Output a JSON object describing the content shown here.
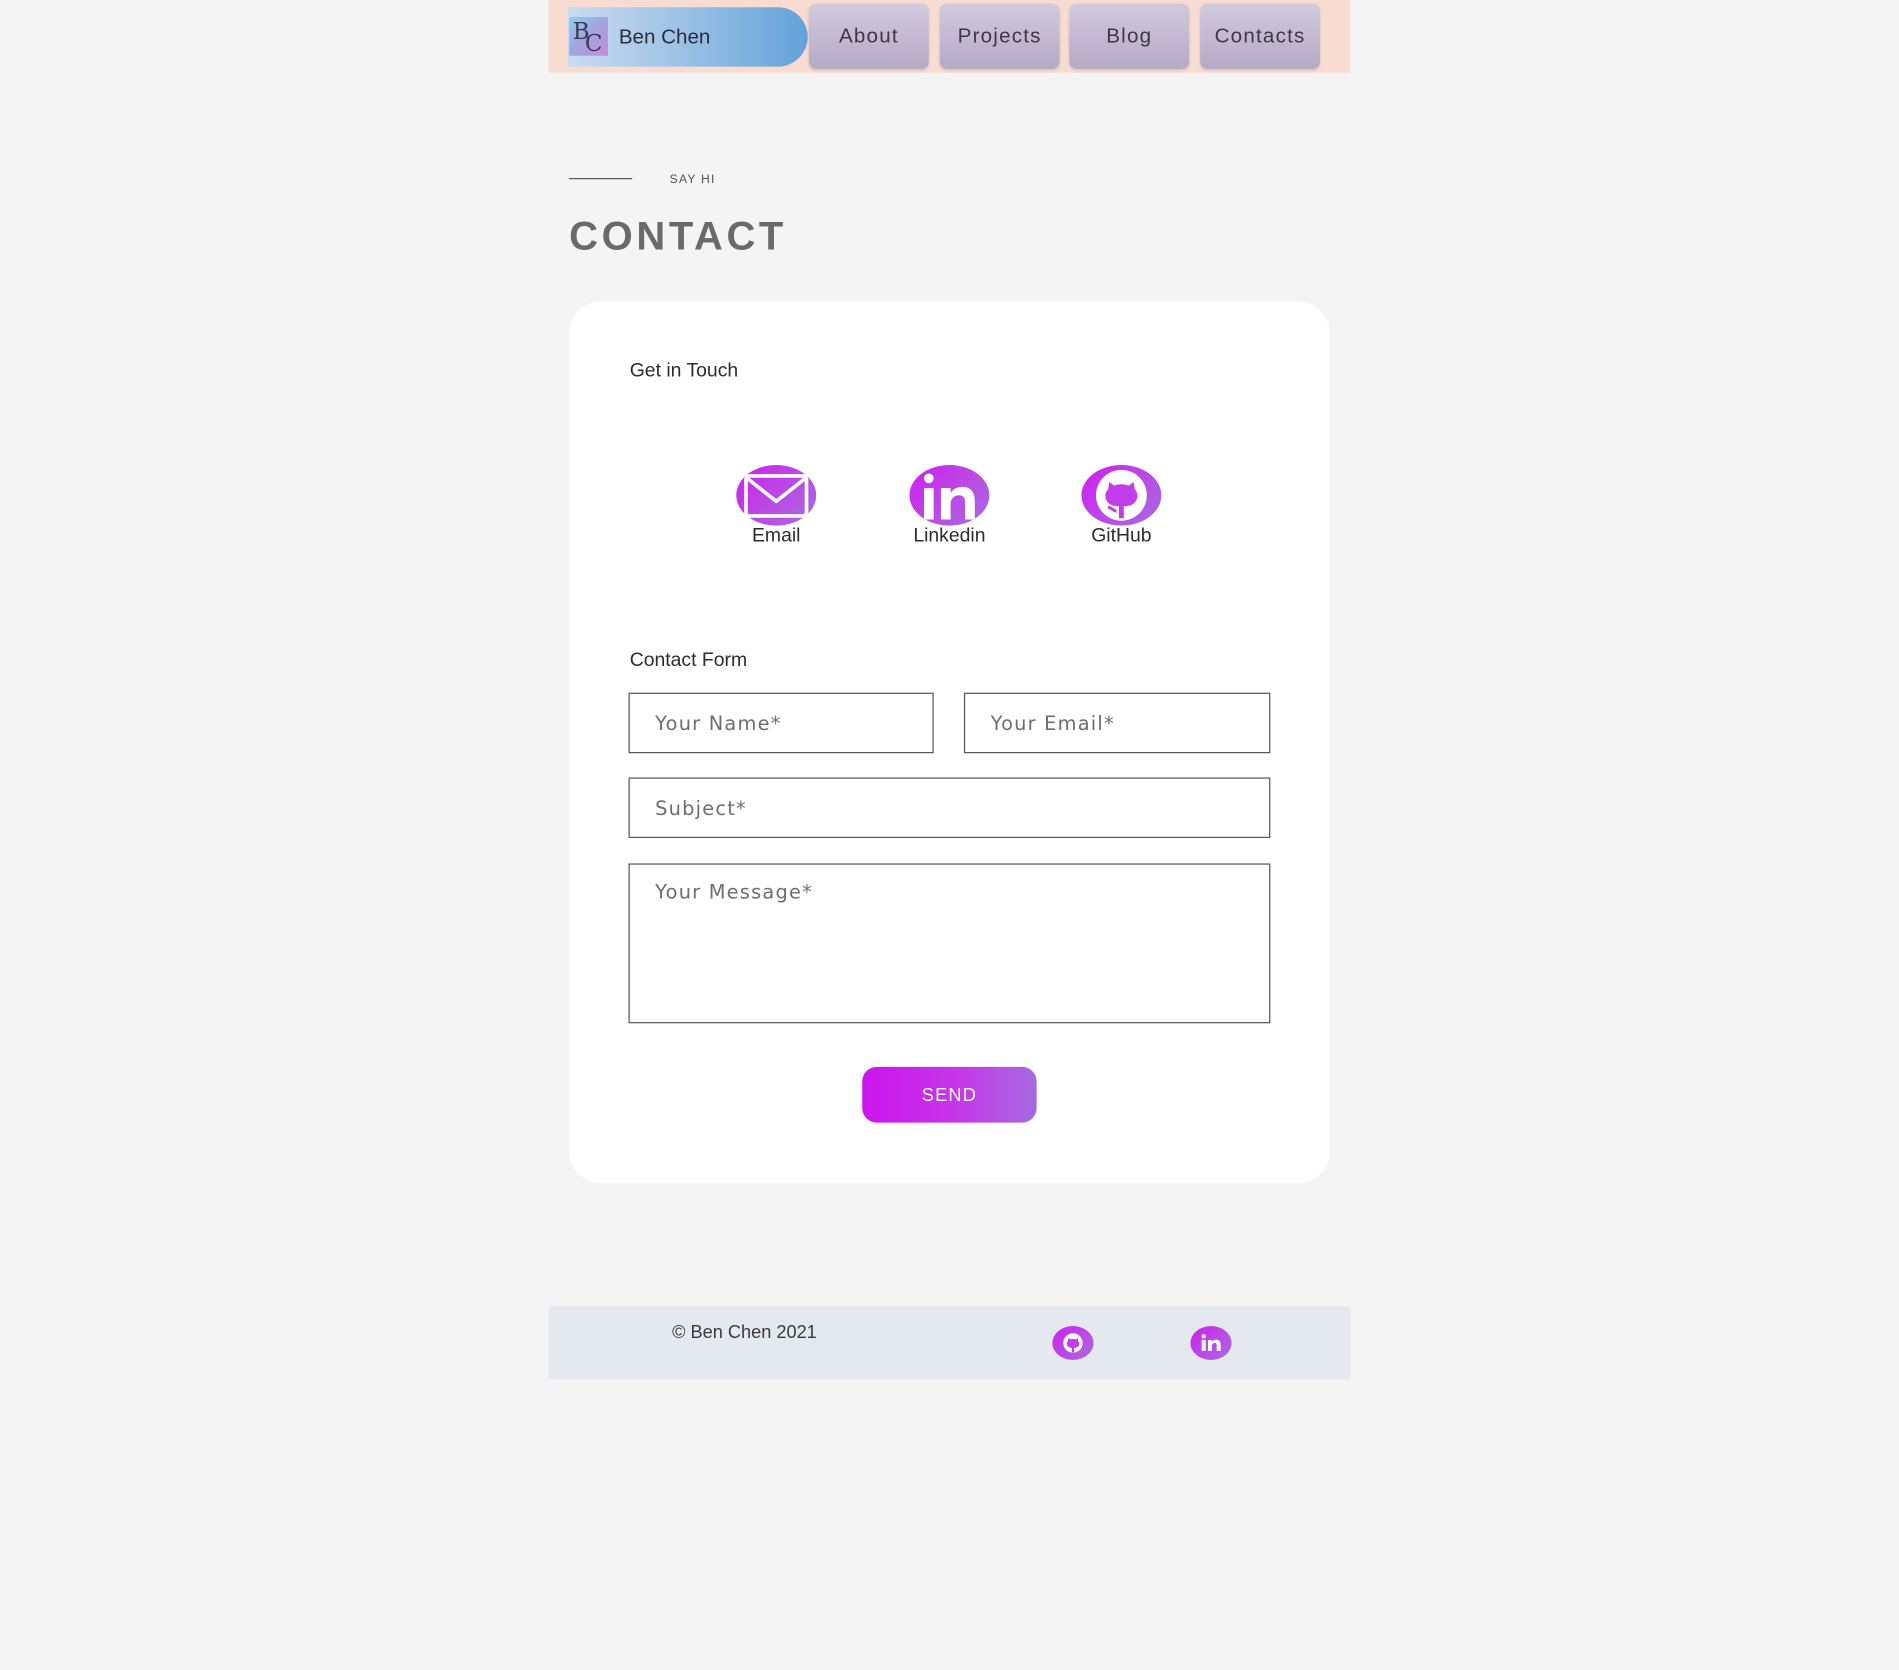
{
  "header": {
    "brand": {
      "logo_letters": [
        "B",
        "C"
      ],
      "name": "Ben Chen"
    },
    "nav": [
      {
        "label": "About"
      },
      {
        "label": "Projects"
      },
      {
        "label": "Blog"
      },
      {
        "label": "Contacts"
      }
    ]
  },
  "section": {
    "eyebrow": "SAY HI",
    "title": "CONTACT"
  },
  "card": {
    "touch_heading": "Get in Touch",
    "socials": [
      {
        "label": "Email",
        "icon": "envelope-icon"
      },
      {
        "label": "Linkedin",
        "icon": "linkedin-icon"
      },
      {
        "label": "GitHub",
        "icon": "github-icon"
      }
    ],
    "form_heading": "Contact Form",
    "form": {
      "name_placeholder": "Your Name*",
      "email_placeholder": "Your Email*",
      "subject_placeholder": "Subject*",
      "message_placeholder": "Your Message*",
      "send_label": "SEND"
    }
  },
  "footer": {
    "copyright": "© Ben Chen 2021",
    "icons": [
      "github-icon",
      "linkedin-icon"
    ]
  },
  "colors": {
    "accent_start": "#cc14ee",
    "accent_end": "#a46be0",
    "header_bg": "#f8dcd2",
    "footer_bg": "#e4e9ef",
    "page_bg": "#f3f4f3"
  }
}
